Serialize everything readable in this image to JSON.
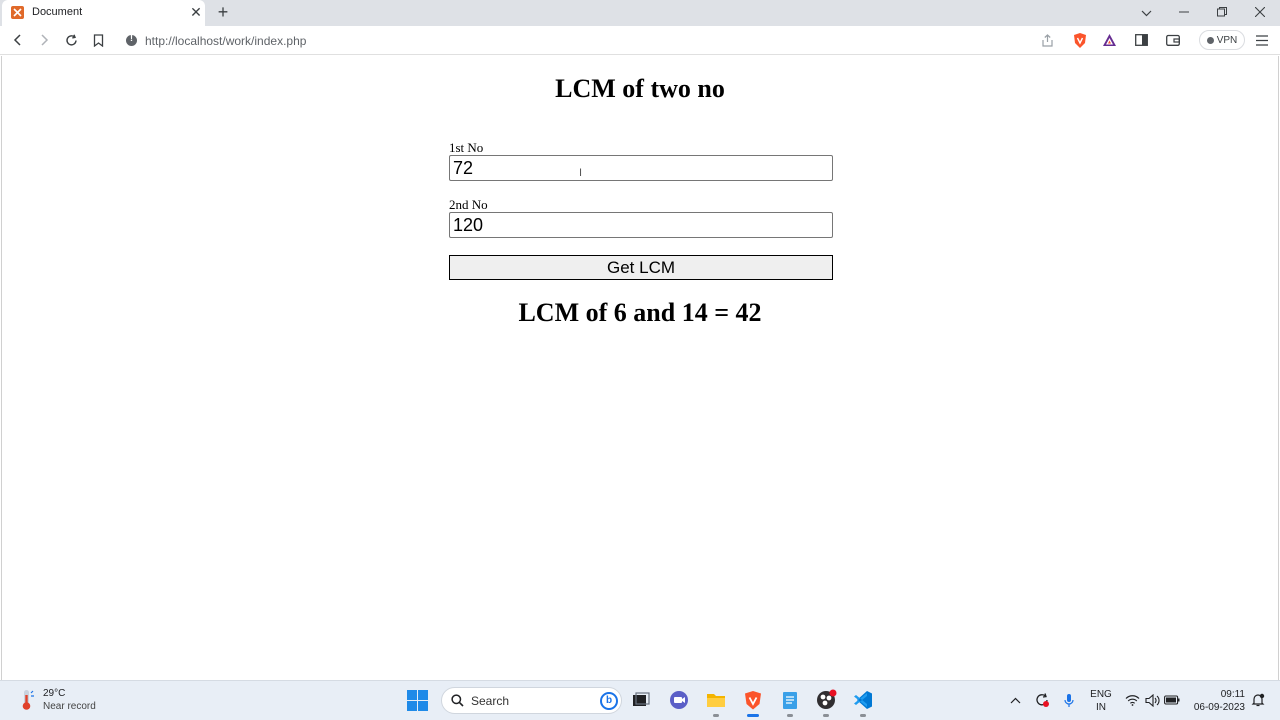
{
  "browser": {
    "tab_title": "Document",
    "tab_close": "✕",
    "new_tab": "+",
    "url": "http://localhost/work/index.php",
    "vpn_label": "VPN"
  },
  "page": {
    "title": "LCM of two no",
    "first_label": "1st No",
    "first_value": "72",
    "second_label": "2nd No",
    "second_value": "120",
    "submit_label": "Get LCM",
    "result": "LCM of 6 and 14 = 42"
  },
  "taskbar": {
    "weather_temp": "29°C",
    "weather_desc": "Near record",
    "search_placeholder": "Search",
    "lang_line1": "ENG",
    "lang_line2": "IN",
    "time": "09:11",
    "date": "06-09-2023"
  },
  "colors": {
    "accent": "#1a73e8",
    "brave": "#fb542b"
  }
}
